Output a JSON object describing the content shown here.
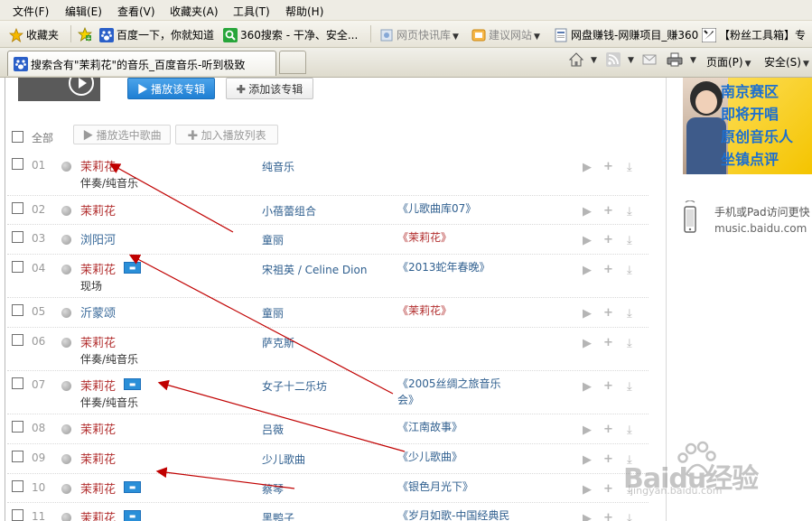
{
  "menu": [
    "文件(F)",
    "编辑(E)",
    "查看(V)",
    "收藏夹(A)",
    "工具(T)",
    "帮助(H)"
  ],
  "favorites": {
    "label": "收藏夹",
    "items": [
      "百度一下，你就知道",
      "360搜索 - 干净、安全...",
      "网页快讯库",
      "建议网站",
      "网盘赚钱-网赚项目_赚360",
      "【粉丝工具箱】专"
    ]
  },
  "tab": {
    "title": "搜索含有\"茉莉花\"的音乐_百度音乐-听到极致"
  },
  "commandbar": {
    "page": "页面(P)",
    "safety": "安全(S)"
  },
  "album": {
    "play_label": "播放该专辑",
    "add_label": "添加该专辑"
  },
  "list": {
    "select_all": "全部",
    "play_selected": "播放选中歌曲",
    "add_playlist": "加入播放列表",
    "rows": [
      {
        "num": "01",
        "title": "茉莉花",
        "sub": "伴奏/纯音乐",
        "artist": "纯音乐",
        "album": "",
        "hq": false
      },
      {
        "num": "02",
        "title": "茉莉花",
        "sub": "",
        "artist": "小蓓蕾组合",
        "album": "《儿歌曲库07》",
        "hq": false
      },
      {
        "num": "03",
        "title": "浏阳河",
        "sub": "",
        "artist": "童丽",
        "album": "《茉莉花》",
        "hq": false
      },
      {
        "num": "04",
        "title": "茉莉花",
        "sub": "现场",
        "artist": "宋祖英 / Celine Dion",
        "album": "《2013蛇年春晚》",
        "hq": true
      },
      {
        "num": "05",
        "title": "沂蒙颂",
        "sub": "",
        "artist": "童丽",
        "album": "《茉莉花》",
        "hq": false
      },
      {
        "num": "06",
        "title": "茉莉花",
        "sub": "伴奏/纯音乐",
        "artist": "萨克斯",
        "album": "",
        "hq": false
      },
      {
        "num": "07",
        "title": "茉莉花",
        "sub": "伴奏/纯音乐",
        "artist": "女子十二乐坊",
        "album": "《2005丝绸之旅音乐会》",
        "hq": true
      },
      {
        "num": "08",
        "title": "茉莉花",
        "sub": "",
        "artist": "吕薇",
        "album": "《江南故事》",
        "hq": false
      },
      {
        "num": "09",
        "title": "茉莉花",
        "sub": "",
        "artist": "少儿歌曲",
        "album": "《少儿歌曲》",
        "hq": false
      },
      {
        "num": "10",
        "title": "茉莉花",
        "sub": "",
        "artist": "蔡琴",
        "album": "《银色月光下》",
        "hq": true
      },
      {
        "num": "11",
        "title": "茉莉花",
        "sub": "",
        "artist": "黑鸭子",
        "album": "《岁月如歌-中国经典民",
        "hq": true
      }
    ]
  },
  "sidebar": {
    "ad_lines": [
      "南京赛区",
      "即将开唱",
      "原创音乐人",
      "坐镇点评"
    ],
    "mobile_text": "手机或Pad访问更快",
    "mobile_url": "music.baidu.com"
  },
  "watermark": {
    "brand": "Baidu经验",
    "url": "jingyan.baidu.com"
  },
  "colors": {
    "song_red": "#b22e2e",
    "link_blue": "#2f5f8f",
    "arrow_red": "#c00000",
    "button_blue": "#2a8fd8"
  }
}
